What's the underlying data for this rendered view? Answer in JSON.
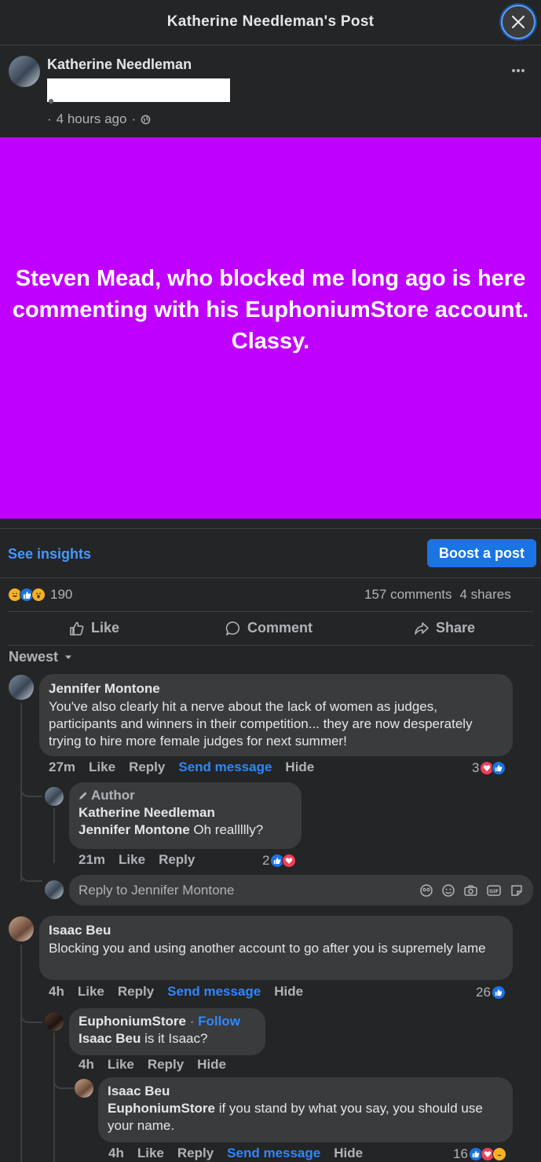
{
  "header": {
    "title": "Katherine Needleman's Post"
  },
  "post": {
    "author": "Katherine Needleman",
    "time": "4 hours ago",
    "text": "Steven Mead, who blocked me long ago is here commenting with his EuphoniumStore account. Classy.",
    "background_color": "#c000ff"
  },
  "actions": {
    "insights": "See insights",
    "boost": "Boost a post"
  },
  "stats": {
    "reactions_count": "190",
    "comments": "157 comments",
    "shares": "4 shares"
  },
  "buttons": {
    "like": "Like",
    "comment": "Comment",
    "share": "Share"
  },
  "sort": {
    "label": "Newest"
  },
  "comments": [
    {
      "name": "Jennifer Montone",
      "text": "You've also clearly hit a nerve about the lack of women as judges, participants and winners in their competition... they are now desperately trying to hire more female judges for next summer!",
      "time": "27m",
      "like": "Like",
      "reply": "Reply",
      "send": "Send message",
      "hide": "Hide",
      "reactions": "3",
      "replies": [
        {
          "badge": "Author",
          "name": "Katherine Needleman",
          "mention": "Jennifer Montone",
          "text": "Oh reallllly?",
          "time": "21m",
          "like": "Like",
          "reply": "Reply",
          "reactions": "2"
        }
      ],
      "reply_placeholder": "Reply to Jennifer Montone"
    },
    {
      "name": "Isaac Beu",
      "text": "Blocking you and using another account to go after you is supremely lame",
      "time": "4h",
      "like": "Like",
      "reply": "Reply",
      "send": "Send message",
      "hide": "Hide",
      "reactions": "26",
      "replies": [
        {
          "name": "EuphoniumStore",
          "follow": "Follow",
          "mention": "Isaac Beu",
          "text": "is it Isaac?",
          "time": "4h",
          "like": "Like",
          "reply": "Reply",
          "hide": "Hide"
        },
        {
          "name": "Isaac Beu",
          "mention": "EuphoniumStore",
          "text": "if you stand by what you say, you should use your name.",
          "time": "4h",
          "like": "Like",
          "reply": "Reply",
          "send": "Send message",
          "hide": "Hide",
          "reactions": "16"
        }
      ]
    }
  ],
  "colors": {
    "background": "#242526",
    "bubble": "#3a3b3c",
    "accent": "#2d88ff",
    "button": "#1b74e4"
  }
}
